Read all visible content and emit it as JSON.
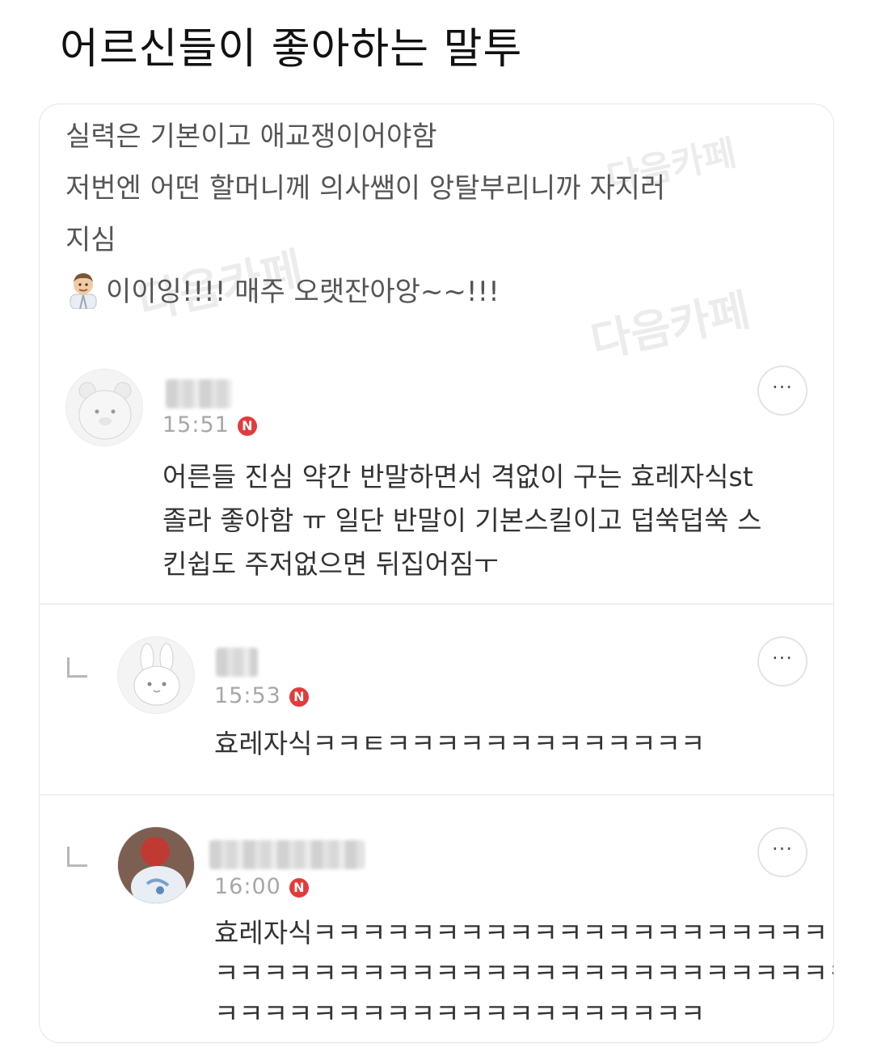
{
  "page": {
    "title": "어르신들이 좋아하는 말투"
  },
  "post": {
    "lines": [
      "실력은 기본이고 애교쟁이어야함",
      "저번엔 어떤 할머니께 의사쌤이 앙탈부리니까 자지러",
      "지심",
      "이이잉!!!! 매주 오랫잔아앙~~!!!"
    ],
    "doctor_icon": "doctor-emoji-icon",
    "watermark": "다음카페"
  },
  "comments": [
    {
      "time": "15:51",
      "badge": "N",
      "avatar_icon": "hamster-avatar-icon",
      "lines": [
        "어른들 진심 약간 반말하면서 격없이 구는 효레자식st",
        "졸라 좋아함 ㅠ 일단 반말이 기본스킬이고 덥쑥덥쑥 스",
        "킨쉽도 주저없으면 뒤집어짐ㅜ"
      ],
      "more_label": "···"
    },
    {
      "time": "15:53",
      "badge": "N",
      "reply": true,
      "avatar_icon": "rabbit-avatar-icon",
      "lines": [
        "효레자식ㅋㅋㅌㅋㅋㅋㅋㅋㅋㅋㅋㅋㅋㅋㅋㅋ"
      ],
      "more_label": "···"
    },
    {
      "time": "16:00",
      "badge": "N",
      "reply": true,
      "avatar_icon": "photo-avatar-icon",
      "lines": [
        "효레자식ㅋㅋㅋㅋㅋㅋㅋㅋㅋㅋㅋㅋㅋㅋㅋㅋㅋㅋㅋㅋㅋ",
        "ㅋㅋㅋㅋㅋㅋㅋㅋㅋㅋㅋㅋㅋㅋㅋㅋㅋㅋㅋㅋㅋㅋㅋㅋㅋㅋ",
        "ㅋㅋㅋㅋㅋㅋㅋㅋㅋㅋㅋㅋㅋㅋㅋㅋㅋㅋㅋㅋ"
      ],
      "more_label": "···"
    }
  ],
  "colors": {
    "badge": "#e23b3b",
    "text": "#333333",
    "time": "#a7a7a7"
  }
}
